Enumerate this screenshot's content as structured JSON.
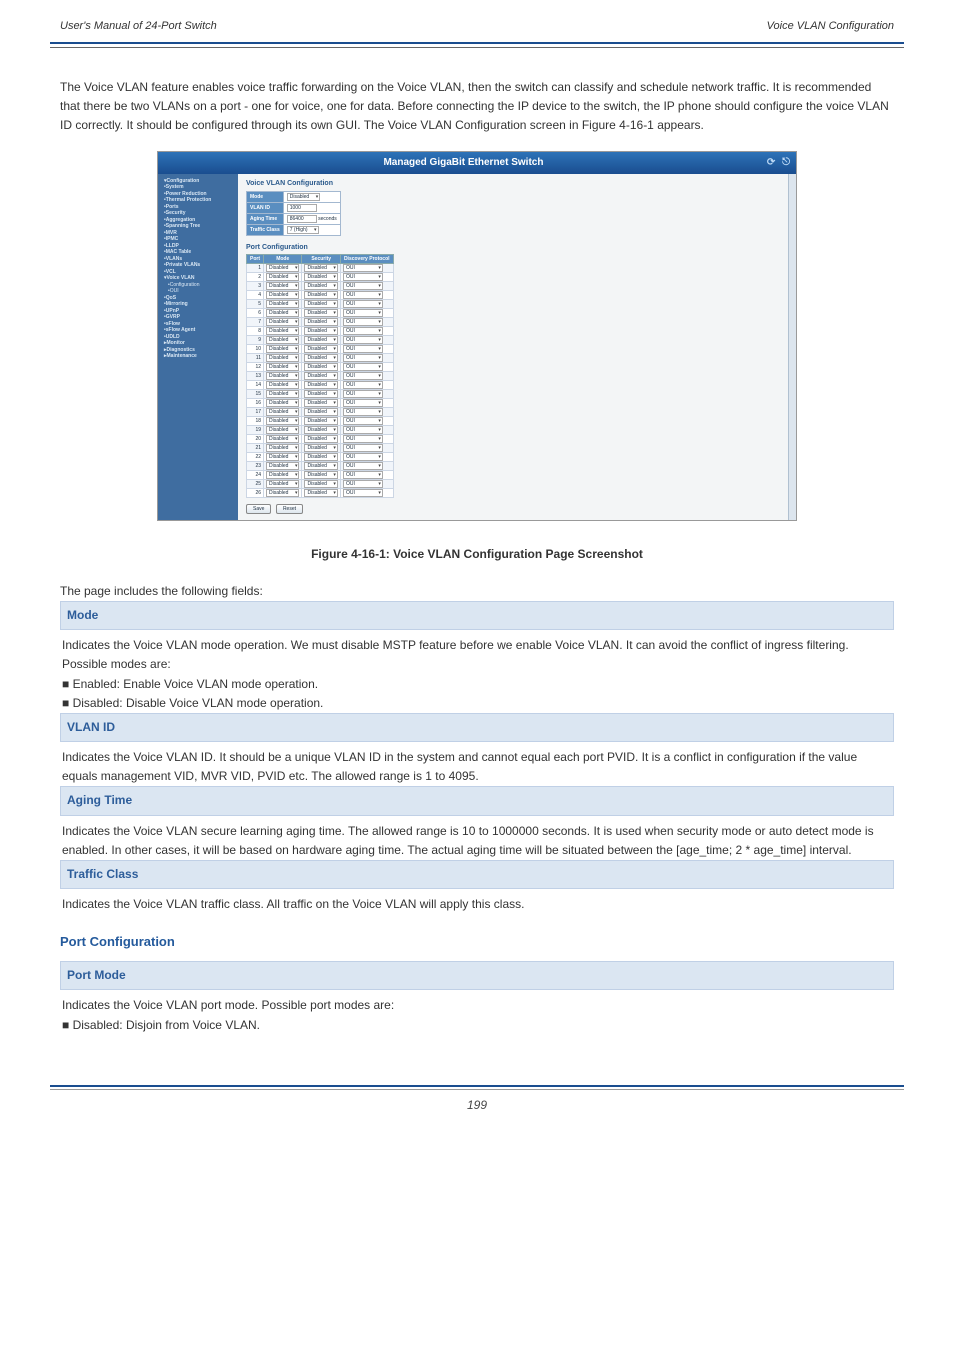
{
  "header": {
    "left": "User's Manual of 24-Port Switch",
    "right": "Voice VLAN Configuration"
  },
  "intro": "The Voice VLAN feature enables voice traffic forwarding on the Voice VLAN, then the switch can classify and schedule network traffic. It is recommended that there be two VLANs on a port - one for voice, one for data. Before connecting the IP device to the switch, the IP phone should configure the voice VLAN ID correctly. It should be configured through its own GUI. The Voice VLAN Configuration screen in Figure 4-16-1 appears.",
  "screenshot": {
    "banner": "Managed GigaBit Ethernet Switch",
    "sidebar": [
      "▾Configuration",
      " •System",
      " •Power Reduction",
      " •Thermal Protection",
      " •Ports",
      " •Security",
      " •Aggregation",
      " •Spanning Tree",
      " •MVR",
      " •IPMC",
      " •LLDP",
      " •MAC Table",
      " •VLANs",
      " •Private VLANs",
      " •VCL",
      " ▾Voice VLAN",
      "  •Configuration",
      "  •OUI",
      " •QoS",
      " •Mirroring",
      " •UPnP",
      " •GVRP",
      " •sFlow",
      " •sFlow Agent",
      " •UDLD",
      "▸Monitor",
      "▸Diagnostics",
      "▸Maintenance"
    ],
    "title": "Voice VLAN Configuration",
    "global": {
      "cols": [
        "",
        ""
      ],
      "rows": [
        {
          "k": "Mode",
          "v": "Disabled",
          "sel": true
        },
        {
          "k": "VLAN ID",
          "v": "1000",
          "sel": false
        },
        {
          "k": "Aging Time",
          "v": "86400",
          "sel": false,
          "unit": "seconds"
        },
        {
          "k": "Traffic Class",
          "v": "7 (High)",
          "sel": true
        }
      ]
    },
    "portTitle": "Port Configuration",
    "portHead": [
      "Port",
      "Mode",
      "Security",
      "Discovery Protocol"
    ],
    "portDefaults": {
      "mode": "Disabled",
      "security": "Disabled",
      "dp": "OUI"
    },
    "portCount": 26,
    "buttons": [
      "Save",
      "Reset"
    ]
  },
  "caption": "Figure 4-16-1: Voice VLAN Configuration Page Screenshot",
  "pageNote": "The page includes the following fields:",
  "fields": [
    {
      "head": "Mode",
      "desc": "Indicates the Voice VLAN mode operation. We must disable MSTP feature before we enable Voice VLAN. It can avoid the conflict of ingress filtering. Possible modes are:\n■ Enabled: Enable Voice VLAN mode operation.\n■ Disabled: Disable Voice VLAN mode operation."
    },
    {
      "head": "VLAN ID",
      "desc": "Indicates the Voice VLAN ID. It should be a unique VLAN ID in the system and cannot equal each port PVID. It is a conflict in configuration if the value equals management VID, MVR VID, PVID etc. The allowed range is 1 to 4095."
    },
    {
      "head": "Aging Time",
      "desc": "Indicates the Voice VLAN secure learning aging time. The allowed range is 10 to 1000000 seconds. It is used when security mode or auto detect mode is enabled. In other cases, it will be based on hardware aging time. The actual aging time will be situated between the [age_time; 2 * age_time] interval."
    },
    {
      "head": "Traffic Class",
      "desc": "Indicates the Voice VLAN traffic class. All traffic on the Voice VLAN will apply this class."
    }
  ],
  "portSection": {
    "title": "Port Configuration",
    "field": {
      "head": "Port Mode",
      "desc": "Indicates the Voice VLAN port mode. Possible port modes are:\n■ Disabled: Disjoin from Voice VLAN."
    }
  },
  "pageNum": "199"
}
